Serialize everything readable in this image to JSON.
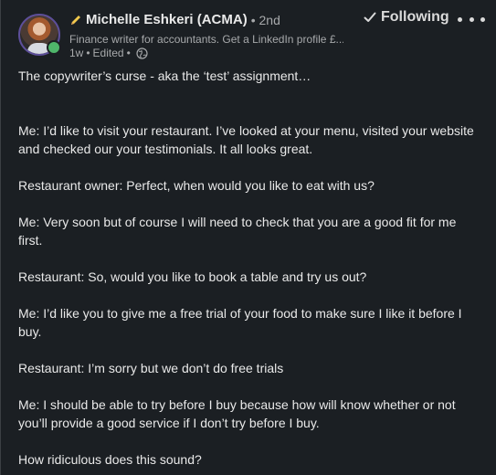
{
  "post": {
    "author": {
      "name": "Michelle Eshkeri (ACMA)",
      "degree": "• 2nd",
      "tagline": "Finance writer for accountants. Get a LinkedIn profile £...",
      "time": "1w",
      "edited": "Edited",
      "separator": "•",
      "online_color": "#4fb66b"
    },
    "follow_label": "Following",
    "paragraphs": [
      "The copywriter’s curse - aka the ‘test’ assignment…",
      "Me: I’d like to visit your restaurant. I’ve looked at your menu, visited your website and checked our your testimonials. It all looks great.",
      "Restaurant owner: Perfect, when would you like to eat with us?",
      "Me: Very soon but of course I will need to check that you are a good fit for me first.",
      "Restaurant: So, would you like to book a table and try us out?",
      "Me: I’d like you to give me a free trial of your food to make sure I like it before I buy.",
      "Restaurant: I’m sorry but we don’t do free trials",
      "Me: I should be able to try before I buy because how will know whether or not you’ll provide a good service if I don’t try before I buy.",
      "How ridiculous does this sound?"
    ]
  },
  "icons": {
    "pencil": "pencil-icon",
    "globe": "globe-icon",
    "check": "check-icon",
    "more": "more-icon"
  }
}
